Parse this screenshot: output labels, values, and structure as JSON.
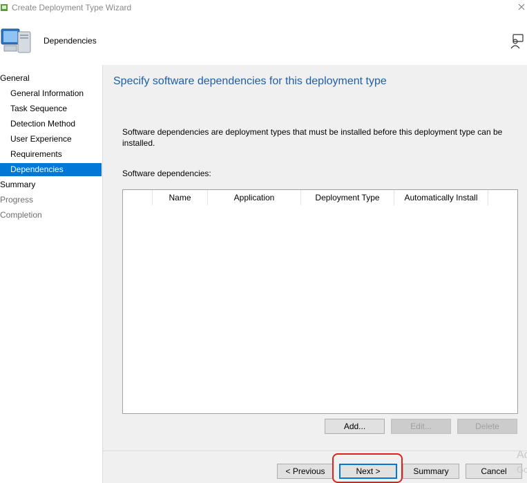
{
  "window": {
    "title": "Create Deployment Type Wizard",
    "icon": "wizard-icon",
    "close_icon": "close-icon"
  },
  "header": {
    "title": "Dependencies",
    "icon": "computer-icon",
    "help_icon": "help-person-icon"
  },
  "sidebar": {
    "items": [
      {
        "label": "General",
        "level": "top",
        "state": "normal"
      },
      {
        "label": "General Information",
        "level": "sub",
        "state": "normal"
      },
      {
        "label": "Task Sequence",
        "level": "sub",
        "state": "normal"
      },
      {
        "label": "Detection Method",
        "level": "sub",
        "state": "normal"
      },
      {
        "label": "User Experience",
        "level": "sub",
        "state": "normal"
      },
      {
        "label": "Requirements",
        "level": "sub",
        "state": "normal"
      },
      {
        "label": "Dependencies",
        "level": "sub",
        "state": "selected"
      },
      {
        "label": "Summary",
        "level": "top",
        "state": "normal"
      },
      {
        "label": "Progress",
        "level": "top",
        "state": "disabled"
      },
      {
        "label": "Completion",
        "level": "top",
        "state": "disabled"
      }
    ]
  },
  "main": {
    "heading": "Specify software dependencies for this deployment type",
    "description": "Software dependencies are deployment types that must be installed before this deployment type can be installed.",
    "list_label": "Software dependencies:",
    "columns": [
      "",
      "Name",
      "Application",
      "Deployment Type",
      "Automatically Install"
    ],
    "rows": []
  },
  "list_buttons": {
    "add": "Add...",
    "edit": "Edit...",
    "delete": "Delete"
  },
  "footer": {
    "previous": "< Previous",
    "next": "Next >",
    "summary": "Summary",
    "cancel": "Cancel"
  },
  "watermark": {
    "line1": "Ac",
    "line2": "Go"
  },
  "colors": {
    "selection": "#0078d7",
    "heading": "#1e5ea8",
    "highlight_outline": "#e0201e"
  }
}
